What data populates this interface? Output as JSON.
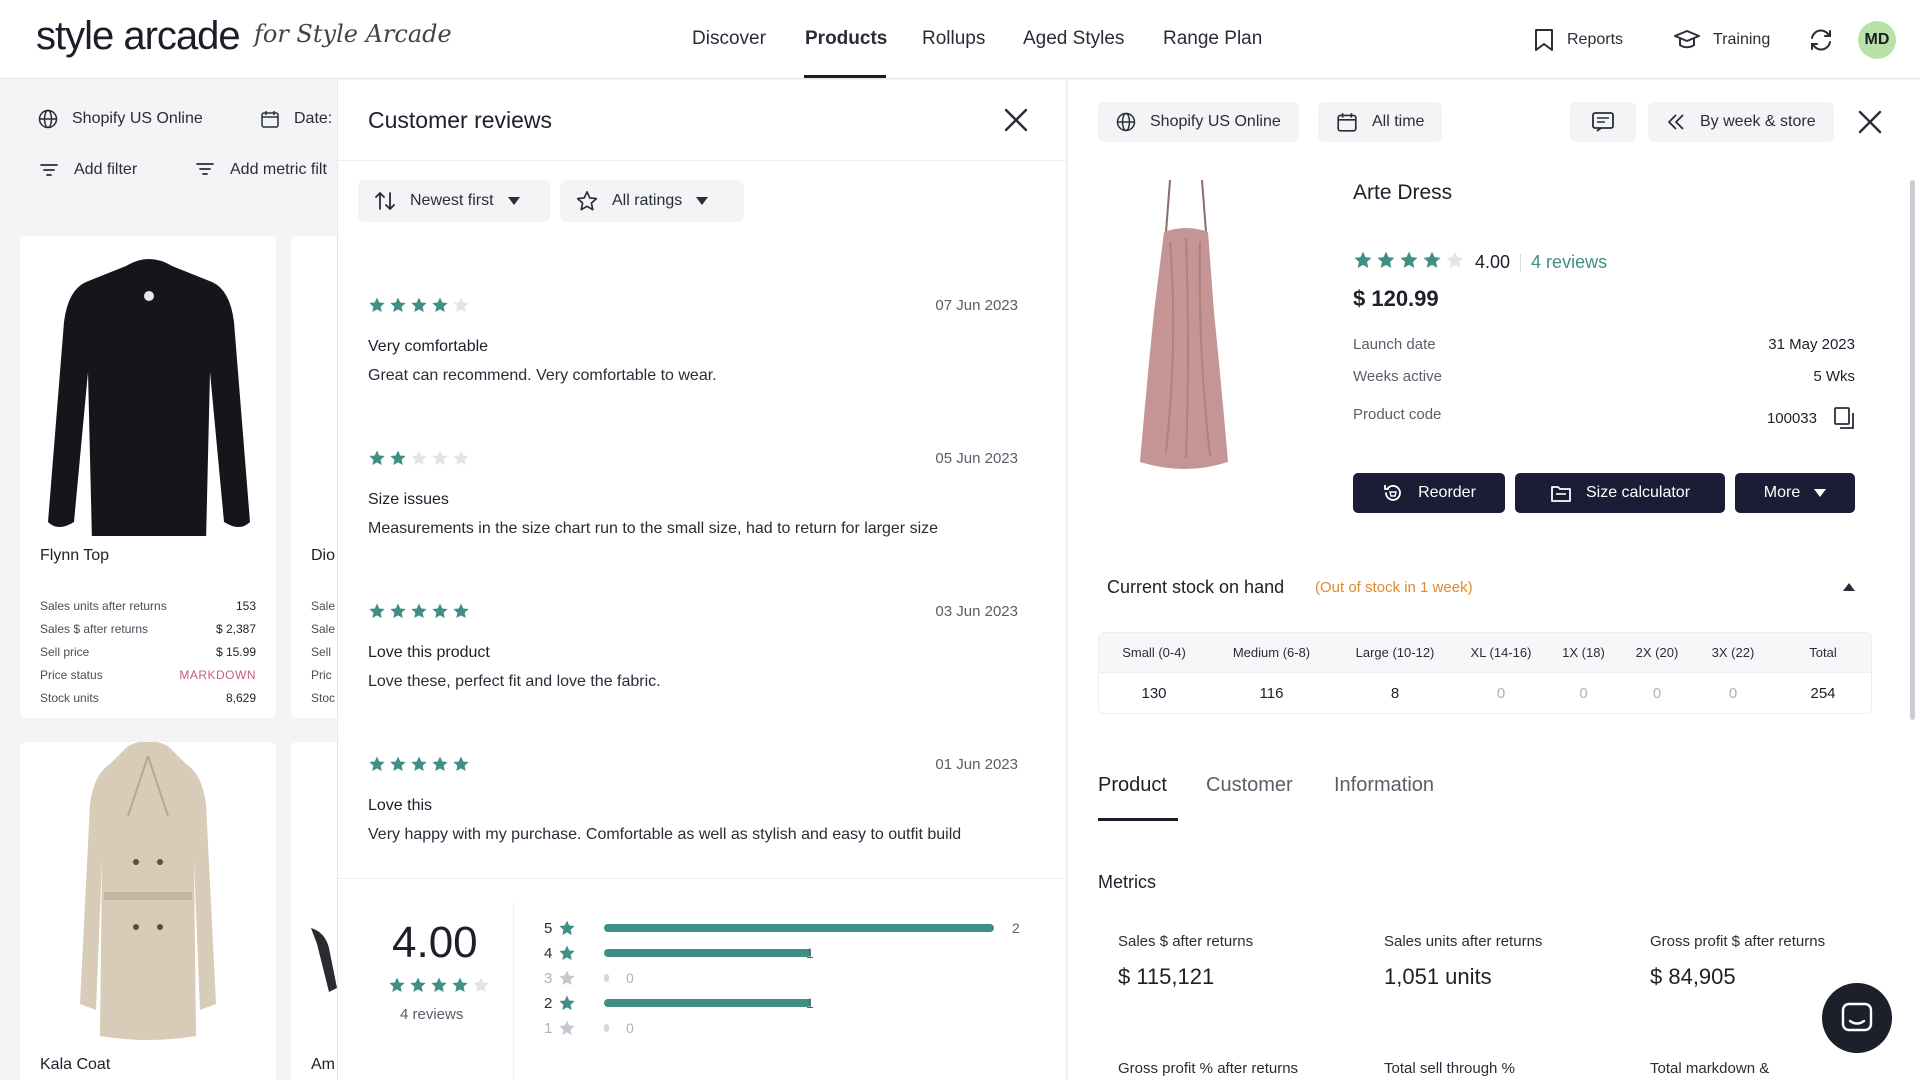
{
  "brand": {
    "logo": "style arcade",
    "subtitle": "for Style Arcade"
  },
  "nav": {
    "items": [
      "Discover",
      "Products",
      "Rollups",
      "Aged Styles",
      "Range Plan"
    ],
    "active": "Products",
    "reports": "Reports",
    "training": "Training",
    "avatar": "MD"
  },
  "background": {
    "store": "Shopify US Online",
    "date_label": "Date:",
    "add_filter": "Add filter",
    "add_metric_filter": "Add metric filt",
    "cards": [
      {
        "name": "Flynn Top",
        "specs": [
          {
            "label": "Sales units after returns",
            "value": "153"
          },
          {
            "label": "Sales $ after returns",
            "value": "$ 2,387"
          },
          {
            "label": "Sell price",
            "value": "$ 15.99"
          },
          {
            "label": "Price status",
            "value": "MARKDOWN"
          },
          {
            "label": "Stock units",
            "value": "8,629"
          }
        ]
      },
      {
        "name": "Dio",
        "spec_prefixes": [
          "Sale",
          "Sale",
          "Sell",
          "Pric",
          "Stoc"
        ]
      },
      {
        "name": "Kala Coat"
      },
      {
        "name": "Am"
      }
    ]
  },
  "reviews_panel": {
    "title": "Customer reviews",
    "sort": "Newest first",
    "filter": "All ratings",
    "reviews": [
      {
        "stars": 4,
        "date": "07 Jun 2023",
        "title": "Very comfortable",
        "body": "Great can recommend. Very comfortable to wear."
      },
      {
        "stars": 2,
        "date": "05 Jun 2023",
        "title": "Size issues",
        "body": "Measurements in the size chart run to the small size, had to return for larger size"
      },
      {
        "stars": 5,
        "date": "03 Jun 2023",
        "title": "Love this product",
        "body": "Love these, perfect fit and love the fabric."
      },
      {
        "stars": 5,
        "date": "01 Jun 2023",
        "title": "Love this",
        "body": "Very happy with my purchase. Comfortable as well as stylish and easy to outfit build"
      }
    ],
    "summary": {
      "average": "4.00",
      "average_stars": 4,
      "count_label": "4 reviews",
      "distribution": [
        {
          "label": "5",
          "count": "2",
          "fraction": 1.0
        },
        {
          "label": "4",
          "count": "1",
          "fraction": 0.53
        },
        {
          "label": "3",
          "count": "0",
          "fraction": 0
        },
        {
          "label": "2",
          "count": "1",
          "fraction": 0.53
        },
        {
          "label": "1",
          "count": "0",
          "fraction": 0
        }
      ]
    }
  },
  "detail": {
    "store": "Shopify US Online",
    "range": "All time",
    "group_by": "By week & store",
    "product_name": "Arte Dress",
    "rating": "4.00",
    "rating_stars": 4,
    "reviews_link": "4 reviews",
    "price": "$ 120.99",
    "fields": [
      {
        "label": "Launch date",
        "value": "31 May 2023"
      },
      {
        "label": "Weeks active",
        "value": "5 Wks"
      },
      {
        "label": "Product code",
        "value": "100033"
      }
    ],
    "buttons": {
      "reorder": "Reorder",
      "size_calc": "Size calculator",
      "more": "More"
    },
    "stock": {
      "title": "Current stock on hand",
      "note": "(Out of stock in 1 week)",
      "headers": [
        "Small (0-4)",
        "Medium (6-8)",
        "Large (10-12)",
        "XL (14-16)",
        "1X (18)",
        "2X (20)",
        "3X (22)",
        "Total"
      ],
      "values": [
        "130",
        "116",
        "8",
        "0",
        "0",
        "0",
        "0",
        "254"
      ]
    },
    "tabs": [
      "Product",
      "Customer",
      "Information"
    ],
    "active_tab": "Product",
    "metrics_title": "Metrics",
    "metrics": [
      {
        "label": "Sales $ after returns",
        "value": "$ 115,121"
      },
      {
        "label": "Sales units after returns",
        "value": "1,051 units"
      },
      {
        "label": "Gross profit $ after returns",
        "value": "$ 84,905"
      },
      {
        "label": "Gross profit % after returns",
        "value": ""
      },
      {
        "label": "Total sell through %",
        "value": ""
      },
      {
        "label": "Total markdown &",
        "value": ""
      }
    ]
  },
  "colors": {
    "accent": "#3f8f85",
    "dark_button": "#1b1d36",
    "warning": "#e08a2c",
    "markdown": "#c6607b"
  }
}
